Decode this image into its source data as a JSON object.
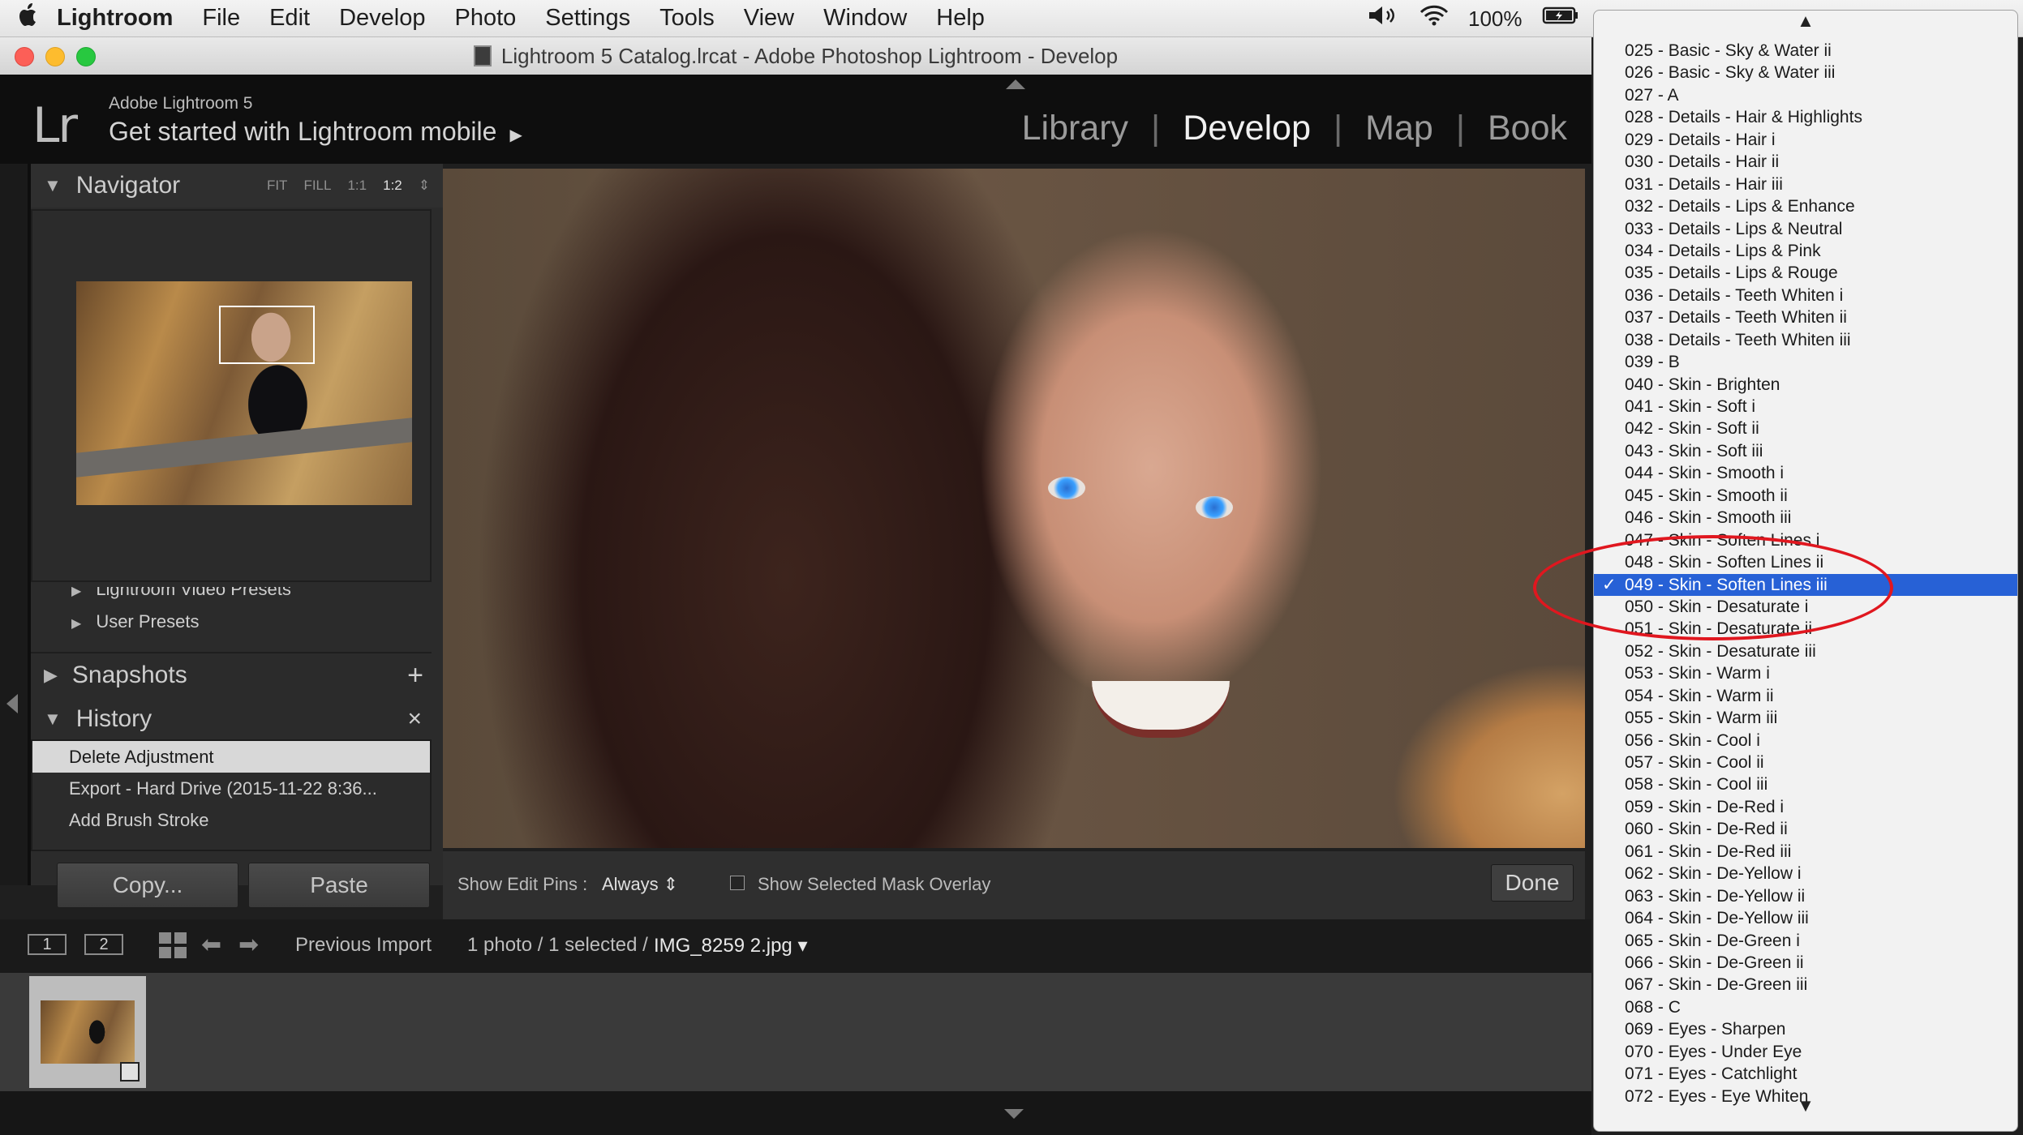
{
  "menubar": {
    "apple": "",
    "app": "Lightroom",
    "items": [
      "File",
      "Edit",
      "Develop",
      "Photo",
      "Settings",
      "Tools",
      "View",
      "Window",
      "Help"
    ],
    "battery": "100%"
  },
  "window": {
    "title": "Lightroom 5 Catalog.lrcat - Adobe Photoshop Lightroom - Develop"
  },
  "header": {
    "logo": "Lr",
    "small": "Adobe Lightroom 5",
    "big": "Get started with Lightroom mobile",
    "arrow": "▶",
    "modules": [
      "Library",
      "Develop",
      "Map",
      "Book"
    ],
    "active_module": "Develop"
  },
  "left": {
    "navigator": {
      "title": "Navigator",
      "opts": [
        "FIT",
        "FILL",
        "1:1",
        "1:2"
      ],
      "selected": "1:2"
    },
    "presets": [
      "Lightroom Video Presets",
      "User Presets"
    ],
    "snapshots": "Snapshots",
    "history": {
      "title": "History",
      "items": [
        "Delete Adjustment",
        "Export - Hard Drive (2015-11-22 8:36...",
        "Add Brush Stroke"
      ]
    },
    "copy": "Copy...",
    "paste": "Paste"
  },
  "toolbar": {
    "edit_pins_label": "Show Edit Pins :",
    "edit_pins_value": "Always",
    "mask_overlay": "Show Selected Mask Overlay",
    "done": "Done"
  },
  "filmstrip": {
    "view1": "1",
    "view2": "2",
    "source": "Previous Import",
    "count": "1 photo / 1 selected /",
    "filename": "IMG_8259 2.jpg"
  },
  "preset_menu": {
    "items": [
      "025 - Basic - Sky & Water ii",
      "026 - Basic - Sky & Water iii",
      "027 - A",
      "028 - Details - Hair & Highlights",
      "029 - Details - Hair i",
      "030 - Details - Hair ii",
      "031 - Details - Hair iii",
      "032 - Details - Lips & Enhance",
      "033 - Details - Lips & Neutral",
      "034 - Details - Lips & Pink",
      "035 - Details - Lips & Rouge",
      "036 - Details - Teeth Whiten i",
      "037 - Details - Teeth Whiten ii",
      "038 - Details - Teeth Whiten iii",
      "039 - B",
      "040 - Skin - Brighten",
      "041 - Skin - Soft i",
      "042 - Skin - Soft ii",
      "043 - Skin - Soft iii",
      "044 - Skin - Smooth i",
      "045 - Skin - Smooth ii",
      "046 - Skin - Smooth iii",
      "047 - Skin - Soften Lines i",
      "048 - Skin - Soften Lines ii",
      "049 - Skin - Soften Lines iii",
      "050 - Skin - Desaturate i",
      "051 - Skin - Desaturate ii",
      "052 - Skin - Desaturate iii",
      "053 - Skin - Warm i",
      "054 - Skin - Warm ii",
      "055 - Skin - Warm iii",
      "056 - Skin - Cool i",
      "057 - Skin - Cool ii",
      "058 - Skin - Cool iii",
      "059 - Skin - De-Red i",
      "060 - Skin - De-Red ii",
      "061 - Skin - De-Red iii",
      "062 - Skin - De-Yellow i",
      "063 - Skin - De-Yellow ii",
      "064 - Skin - De-Yellow iii",
      "065 - Skin - De-Green i",
      "066 - Skin - De-Green ii",
      "067 - Skin - De-Green iii",
      "068 - C",
      "069 - Eyes - Sharpen",
      "070 - Eyes - Under Eye",
      "071 - Eyes - Catchlight",
      "072 - Eyes - Eye Whiten"
    ],
    "selected_index": 24,
    "check": "✓",
    "accent": "#2761d6",
    "annotation_color": "#e0171f"
  }
}
